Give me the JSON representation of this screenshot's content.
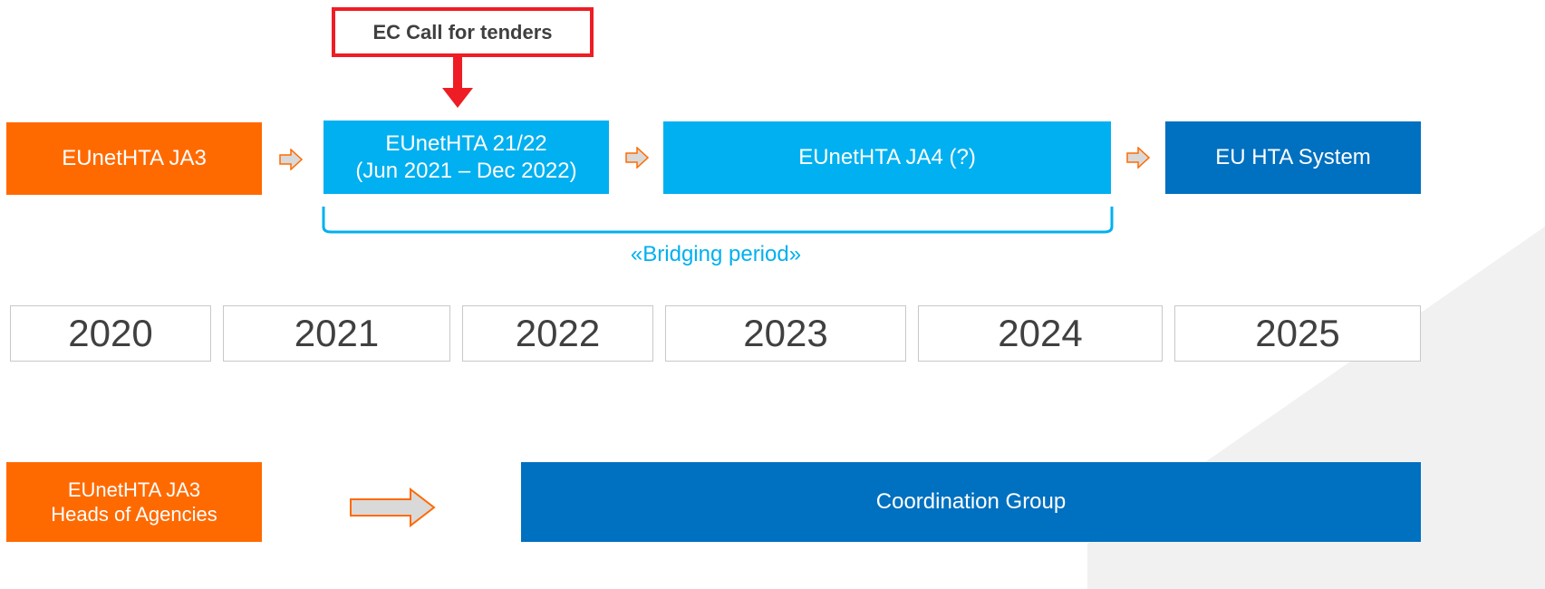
{
  "callout": {
    "label": "EC Call for tenders"
  },
  "timeline": {
    "phases": [
      {
        "line1": "EUnetHTA JA3",
        "line2": ""
      },
      {
        "line1": "EUnetHTA 21/22",
        "line2": "(Jun 2021 – Dec 2022)"
      },
      {
        "line1": "EUnetHTA JA4 (?)",
        "line2": ""
      },
      {
        "line1": "EU HTA System",
        "line2": ""
      }
    ],
    "bridging_label": "«Bridging period»"
  },
  "years": [
    "2020",
    "2021",
    "2022",
    "2023",
    "2024",
    "2025"
  ],
  "governance": {
    "heads_line1": "EUnetHTA JA3",
    "heads_line2": "Heads of Agencies",
    "coordination": "Coordination Group"
  },
  "colors": {
    "orange": "#ff6a00",
    "light_blue": "#00b0f0",
    "dark_blue": "#0070c0",
    "callout_red": "#ee1c25"
  }
}
